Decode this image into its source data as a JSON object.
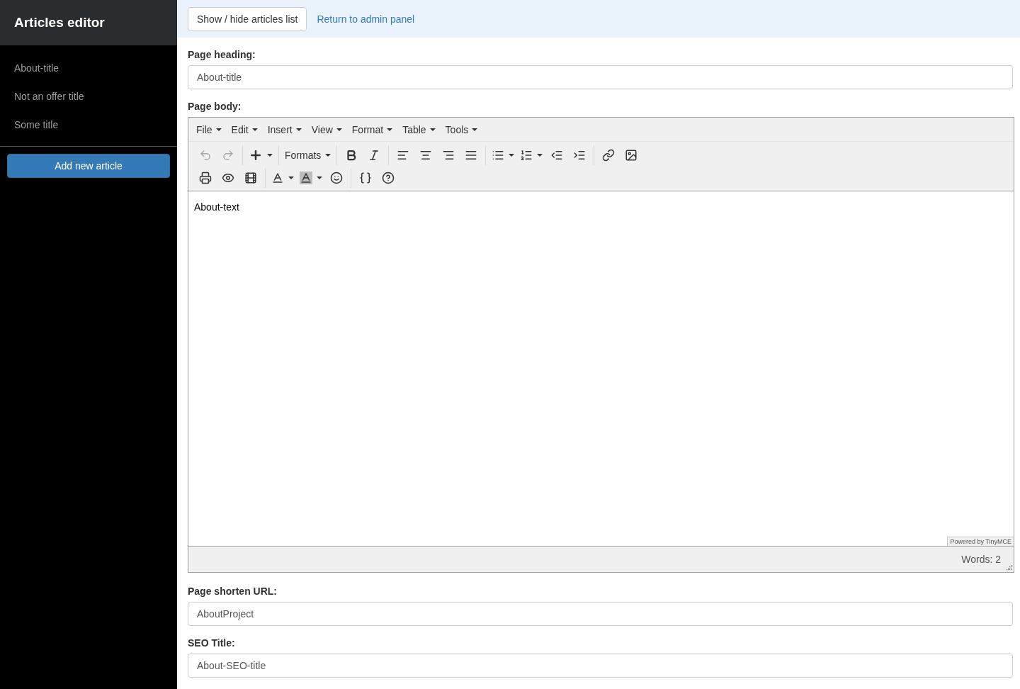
{
  "sidebar": {
    "title": "Articles editor",
    "articles": [
      {
        "label": "About-title",
        "selected": false
      },
      {
        "label": "Not an offer title",
        "selected": false
      },
      {
        "label": "Some title",
        "selected": false
      }
    ],
    "add_button": "Add new article"
  },
  "topbar": {
    "toggle_button": "Show / hide articles list",
    "link": "Return to admin panel"
  },
  "heading_field": {
    "label": "Page heading:",
    "value": "About-title"
  },
  "body_editor": {
    "label": "Page body:",
    "menus": [
      "File",
      "Edit",
      "Insert",
      "View",
      "Format",
      "Table",
      "Tools"
    ],
    "toolbar_rows": [
      [
        [
          {
            "kind": "undo",
            "disabled": true
          },
          {
            "kind": "redo",
            "disabled": true
          }
        ],
        [
          {
            "kind": "insert",
            "disabled": false
          }
        ],
        [
          {
            "kind": "formats",
            "label": "Formats",
            "disabled": false
          }
        ],
        [
          {
            "kind": "bold",
            "disabled": false
          },
          {
            "kind": "italic",
            "disabled": false
          }
        ],
        [
          {
            "kind": "alignleft",
            "disabled": false
          },
          {
            "kind": "aligncenter",
            "disabled": false
          },
          {
            "kind": "alignright",
            "disabled": false
          },
          {
            "kind": "justify",
            "disabled": false
          }
        ],
        [
          {
            "kind": "bullist",
            "disabled": false
          },
          {
            "kind": "numlist",
            "disabled": false
          },
          {
            "kind": "outdent",
            "disabled": false
          },
          {
            "kind": "indent",
            "disabled": false
          }
        ],
        [
          {
            "kind": "link",
            "disabled": false
          },
          {
            "kind": "image",
            "disabled": false
          }
        ]
      ],
      [
        [
          {
            "kind": "print",
            "disabled": false
          },
          {
            "kind": "preview",
            "disabled": false
          },
          {
            "kind": "media",
            "disabled": false
          }
        ],
        [
          {
            "kind": "forecolor",
            "disabled": false
          },
          {
            "kind": "backcolor",
            "disabled": false
          },
          {
            "kind": "emoticons",
            "disabled": false
          }
        ],
        [
          {
            "kind": "code",
            "disabled": false
          },
          {
            "kind": "help",
            "disabled": false
          }
        ]
      ]
    ],
    "content": "About-text",
    "branding": "Powered by TinyMCE",
    "word_count": "Words: 2"
  },
  "url_field": {
    "label": "Page shorten URL:",
    "value": "AboutProject"
  },
  "seo_field": {
    "label": "SEO Title:",
    "value": "About-SEO-title"
  }
}
